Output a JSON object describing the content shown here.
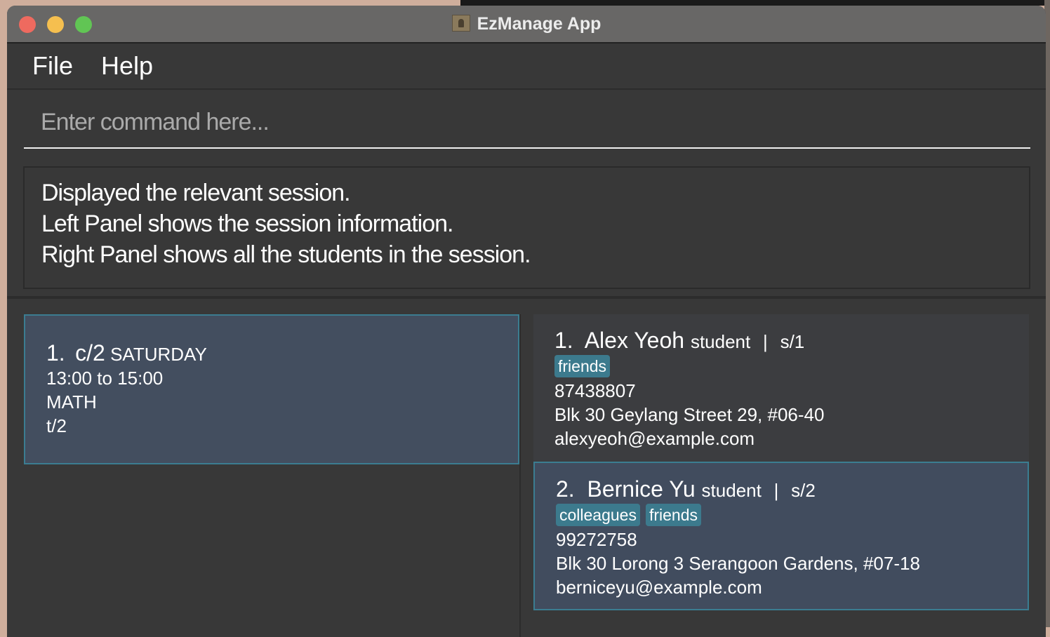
{
  "window": {
    "title": "EzManage App",
    "traffic_lights": {
      "close": "#ee6a5f",
      "minimize": "#f5bf4f",
      "zoom": "#61c554"
    }
  },
  "menu": {
    "items": [
      "File",
      "Help"
    ]
  },
  "command": {
    "placeholder": "Enter command here...",
    "value": ""
  },
  "result": {
    "lines": [
      "Displayed the relevant session.",
      "Left Panel shows the session information.",
      "Right Panel shows all the students in the session."
    ]
  },
  "session": {
    "index": "1.",
    "code": "c/2",
    "day": "SATURDAY",
    "time": "13:00 to 15:00",
    "subject": "MATH",
    "tutor": "t/2"
  },
  "students": [
    {
      "index": "1.",
      "name": "Alex Yeoh",
      "role": "student",
      "sep": "|",
      "id": "s/1",
      "tags": [
        "friends"
      ],
      "phone": "87438807",
      "address": "Blk 30 Geylang Street 29, #06-40",
      "email": "alexyeoh@example.com"
    },
    {
      "index": "2.",
      "name": "Bernice Yu",
      "role": "student",
      "sep": "|",
      "id": "s/2",
      "tags": [
        "colleagues",
        "friends"
      ],
      "phone": "99272758",
      "address": "Blk 30 Lorong 3 Serangoon Gardens, #07-18",
      "email": "berniceyu@example.com"
    }
  ],
  "colors": {
    "accent": "#3b7d91",
    "card_selected": "#434e5f",
    "background": "#383838"
  }
}
